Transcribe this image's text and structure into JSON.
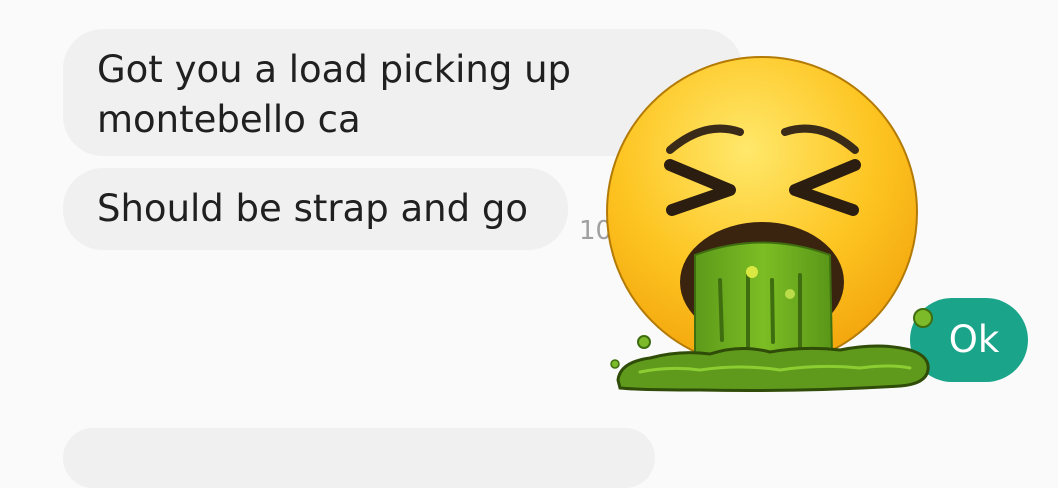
{
  "messages": [
    {
      "text": "Got you a load picking up montebello ca"
    },
    {
      "text": "Should be strap and go",
      "time": "10"
    },
    {
      "text": ""
    }
  ],
  "reply": {
    "label": "Ok"
  },
  "sticker": {
    "icon": "nauseated-vomiting-face-icon"
  },
  "colors": {
    "background": "#fafafa",
    "bubble": "#f0f0f0",
    "text": "#202020",
    "timestamp": "#a0a0a0",
    "reply_button": "#1aa58a",
    "emoji_face": "#fcc21b",
    "vomit": "#6ba81f"
  }
}
